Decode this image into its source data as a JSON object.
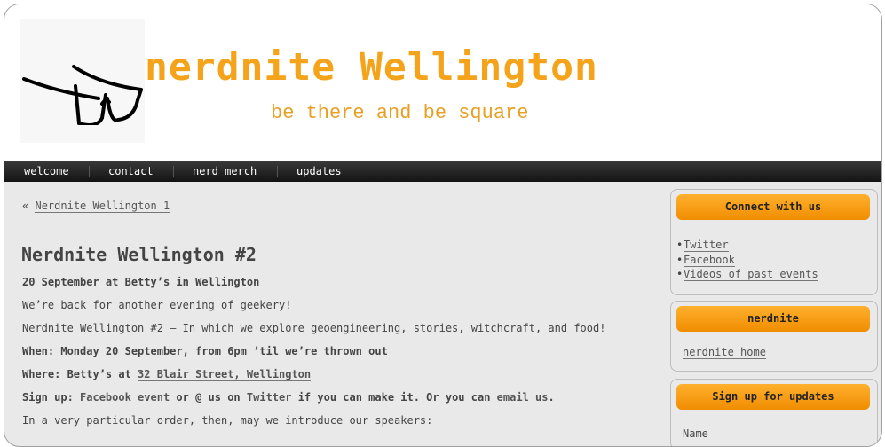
{
  "header": {
    "site_title": "nerdnite Wellington",
    "tagline": "be there and be square",
    "logo_icon": "glasses-logo"
  },
  "nav": {
    "items": [
      "welcome",
      "contact",
      "nerd merch",
      "updates"
    ]
  },
  "post": {
    "prev_arrow": "«",
    "prev_link": "Nerdnite Wellington 1",
    "title": "Nerdnite Wellington #2",
    "subtitle": "20 September at Betty’s in Wellington",
    "intro": "We’re back for another evening of geekery!",
    "summary": "Nerdnite Wellington #2 – In which we explore geoengineering, stories, witchcraft, and food!",
    "when": "When: Monday 20 September, from 6pm ’til we’re thrown out",
    "where_label": "Where: Betty’s at ",
    "where_link": "32 Blair Street, Wellington",
    "signup_label": "Sign up: ",
    "signup_fb": "Facebook event",
    "signup_mid": " or @ us on ",
    "signup_twitter": "Twitter",
    "signup_mid2": " if you can make it. Or you can ",
    "signup_email": "email us",
    "signup_end": ".",
    "speakers_intro": "In a very particular order, then, may we introduce our speakers:"
  },
  "sidebar": {
    "connect": {
      "title": "Connect with us",
      "links": [
        "Twitter",
        "Facebook",
        "Videos of past events"
      ]
    },
    "nerdnite": {
      "title": "nerdnite",
      "link": "nerdnite home"
    },
    "signup": {
      "title": "Sign up for updates",
      "name_label": "Name"
    }
  },
  "colors": {
    "accent": "#f5a31a",
    "nav_bg": "#1e1e1e",
    "page_bg": "#e9e9e9"
  }
}
